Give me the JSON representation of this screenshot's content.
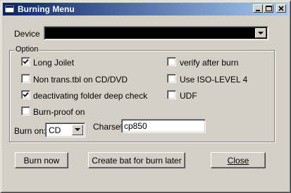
{
  "window": {
    "title": "Burning Menu"
  },
  "device": {
    "label": "Device",
    "value": ""
  },
  "option": {
    "label": "Option",
    "left": [
      {
        "label": "Long Joilet",
        "checked": true
      },
      {
        "label": "Non trans.tbl on CD/DVD",
        "checked": false
      },
      {
        "label": "deactivating folder deep check",
        "checked": true
      },
      {
        "label": "Burn-proof on",
        "checked": false
      }
    ],
    "right": [
      {
        "label": "verify after burn",
        "checked": false
      },
      {
        "label": "Use ISO-LEVEL 4",
        "checked": false
      },
      {
        "label": "UDF",
        "checked": false
      }
    ],
    "burn_on_label": "Burn on:",
    "burn_on_value": "CD",
    "charset_label": "Charset:",
    "charset_value": "cp850"
  },
  "buttons": {
    "burn_now": "Burn now",
    "create_bat": "Create bat for burn later",
    "close": "Close"
  }
}
